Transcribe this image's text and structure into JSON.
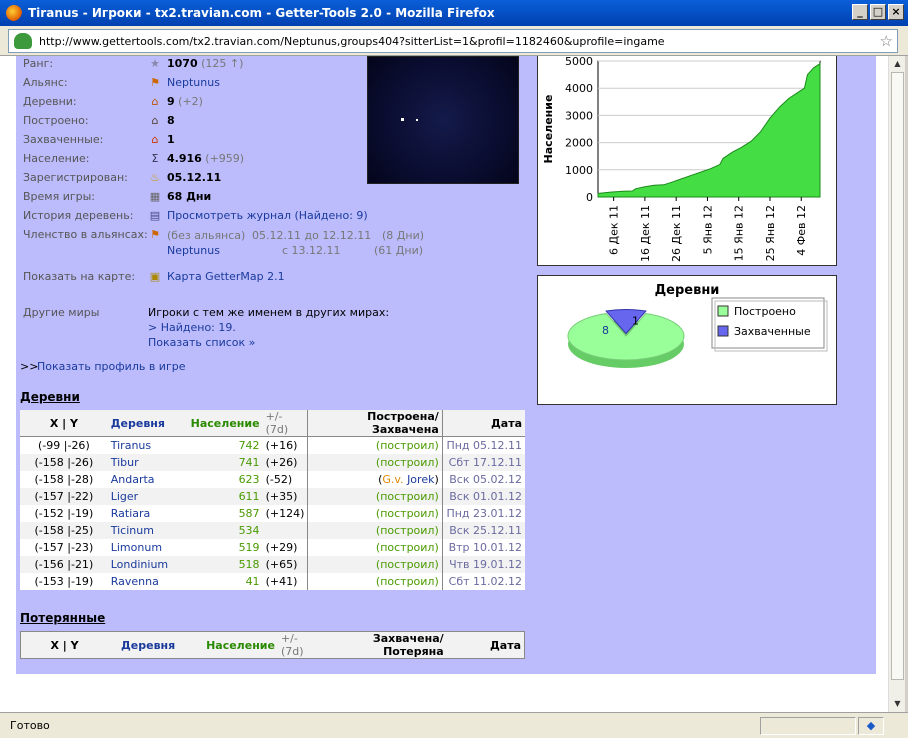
{
  "window": {
    "title": "Tiranus - Игроки - tx2.travian.com - Getter-Tools 2.0 - Mozilla Firefox"
  },
  "url": "http://www.gettertools.com/tx2.travian.com/Neptunus,groups404?sitterList=1&profil=1182460&uprofile=ingame",
  "status": "Готово",
  "profile": {
    "rank_label": "Ранг:",
    "rank": "1070",
    "rank_change": "(125 ↑)",
    "alliance_label": "Альянс:",
    "alliance": "Neptunus",
    "villages_label": "Деревни:",
    "villages": "9",
    "villages_change": "(+2)",
    "built_label": "Построено:",
    "built": "8",
    "captured_label": "Захваченные:",
    "captured": "1",
    "population_label": "Население:",
    "population": "4.916",
    "population_change": "(+959)",
    "registered_label": "Зарегистрирован:",
    "registered": "05.12.11",
    "playtime_label": "Время игры:",
    "playtime": "68 Дни",
    "history_label": "История деревень:",
    "history_link": "Просмотреть журнал (Найдено: 9)",
    "membership_label": "Членство в альянсах:",
    "membership": [
      {
        "name": "(без альянса)",
        "period": "05.12.11 до 12.12.11",
        "days": "(8 Дни)"
      },
      {
        "name": "Neptunus",
        "period": "с 13.12.11",
        "days": "(61 Дни)"
      }
    ],
    "map_label": "Показать на карте:",
    "map_link": "Карта GetterMap 2.1",
    "otherworlds_label": "Другие миры",
    "otherworlds_text": "Игроки с тем же именем в других мирах:",
    "otherworlds_found": "> Найдено: 19.",
    "otherworlds_list": "Показать список »",
    "ingame_prefix": ">>",
    "ingame_link": "Показать профиль в игре"
  },
  "icons": {
    "rank": "rank-icon",
    "alliance": "alliance-icon",
    "villages": "house-icon",
    "built": "built-icon",
    "captured": "captured-icon",
    "population": "sigma-icon",
    "registered": "cake-icon",
    "playtime": "calendar-icon",
    "history": "document-icon",
    "membership": "alliance-history-icon",
    "map": "map-icon"
  },
  "villages_section": {
    "title": "Деревни",
    "headers": {
      "xy": "X | Y",
      "name": "Деревня",
      "pop": "Население",
      "change": "+/- (7d)",
      "type": "Построена/Захвачена",
      "date": "Дата"
    },
    "rows": [
      {
        "x": "-99",
        "y": "-26",
        "name": "Tiranus",
        "pop": "742",
        "change": "(+16)",
        "type": "(построил)",
        "date": "Пнд 05.12.11"
      },
      {
        "x": "-158",
        "y": "-26",
        "name": "Tibur",
        "pop": "741",
        "change": "(+26)",
        "type": "(построил)",
        "date": "Сбт 17.12.11"
      },
      {
        "x": "-158",
        "y": "-28",
        "name": "Andarta",
        "pop": "623",
        "change": "(-52)",
        "type": "(G.v. Jorek)",
        "type_a": "G.v.",
        "type_b": "Jorek",
        "date": "Вск 05.02.12"
      },
      {
        "x": "-157",
        "y": "-22",
        "name": "Liger",
        "pop": "611",
        "change": "(+35)",
        "type": "(построил)",
        "date": "Вск 01.01.12"
      },
      {
        "x": "-152",
        "y": "-19",
        "name": "Ratiara",
        "pop": "587",
        "change": "(+124)",
        "type": "(построил)",
        "date": "Пнд 23.01.12"
      },
      {
        "x": "-158",
        "y": "-25",
        "name": "Ticinum",
        "pop": "534",
        "change": "",
        "type": "(построил)",
        "date": "Вск 25.12.11"
      },
      {
        "x": "-157",
        "y": "-23",
        "name": "Limonum",
        "pop": "519",
        "change": "(+29)",
        "type": "(построил)",
        "date": "Втр 10.01.12"
      },
      {
        "x": "-156",
        "y": "-21",
        "name": "Londinium",
        "pop": "518",
        "change": "(+65)",
        "type": "(построил)",
        "date": "Чтв 19.01.12"
      },
      {
        "x": "-153",
        "y": "-19",
        "name": "Ravenna",
        "pop": "41",
        "change": "(+41)",
        "type": "(построил)",
        "date": "Сбт 11.02.12"
      }
    ]
  },
  "lost_section": {
    "title": "Потерянные",
    "headers": {
      "xy": "X | Y",
      "name": "Деревня",
      "pop": "Население",
      "change": "+/- (7d)",
      "type": "Захвачена/Потеряна",
      "date": "Дата"
    }
  },
  "chart_data": [
    {
      "type": "area",
      "ylabel": "Население",
      "ylim": [
        0,
        5000
      ],
      "yticks": [
        "0",
        "1000",
        "2000",
        "3000",
        "4000",
        "5000"
      ],
      "xticks": [
        "6 Дек 11",
        "16 Дек 11",
        "26 Дек 11",
        "5 Янв 12",
        "15 Янв 12",
        "25 Янв 12",
        "4 Фев 12"
      ],
      "x_start": "2011-12-01",
      "x_end": "2012-02-10",
      "color": "#44dd44",
      "series": [
        {
          "values": [
            [
              "2011-12-01",
              130
            ],
            [
              "2011-12-05",
              180
            ],
            [
              "2011-12-09",
              210
            ],
            [
              "2011-12-12",
              220
            ],
            [
              "2011-12-13",
              300
            ],
            [
              "2011-12-16",
              380
            ],
            [
              "2011-12-19",
              430
            ],
            [
              "2011-12-22",
              450
            ],
            [
              "2011-12-25",
              560
            ],
            [
              "2011-12-28",
              680
            ],
            [
              "2011-12-31",
              800
            ],
            [
              "2012-01-03",
              920
            ],
            [
              "2012-01-06",
              1040
            ],
            [
              "2012-01-09",
              1200
            ],
            [
              "2012-01-10",
              1420
            ],
            [
              "2012-01-13",
              1650
            ],
            [
              "2012-01-16",
              1830
            ],
            [
              "2012-01-19",
              2050
            ],
            [
              "2012-01-22",
              2400
            ],
            [
              "2012-01-25",
              2900
            ],
            [
              "2012-01-28",
              3300
            ],
            [
              "2012-01-31",
              3620
            ],
            [
              "2012-02-03",
              3850
            ],
            [
              "2012-02-05",
              4000
            ],
            [
              "2012-02-06",
              4500
            ],
            [
              "2012-02-08",
              4750
            ],
            [
              "2012-02-10",
              4900
            ]
          ]
        }
      ]
    },
    {
      "type": "pie",
      "title": "Деревни",
      "legend": "right",
      "slices": [
        {
          "name": "Построено",
          "value": 8,
          "label": "8",
          "color": "#99ff99"
        },
        {
          "name": "Захваченные",
          "value": 1,
          "label": "1",
          "color": "#6666ee"
        }
      ]
    }
  ]
}
